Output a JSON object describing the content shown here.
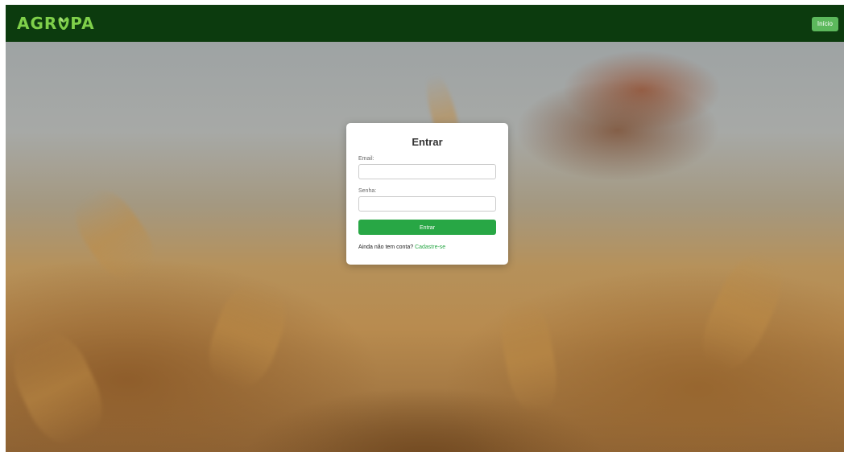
{
  "header": {
    "logo_left": "AGR",
    "logo_right": "PA",
    "nav_button": "Início"
  },
  "login": {
    "title": "Entrar",
    "email_label": "Email:",
    "email_value": "",
    "password_label": "Senha:",
    "password_value": "",
    "submit_label": "Entrar",
    "signup_prompt": "Ainda não tem conta?",
    "signup_link": "Cadastre-se"
  },
  "colors": {
    "navbar": "#0c3b0e",
    "logo": "#7fd04a",
    "nav_button": "#5cb85c",
    "submit": "#28a745",
    "link": "#28a745"
  },
  "icons": {
    "logo_mark": "leaf-icon"
  }
}
